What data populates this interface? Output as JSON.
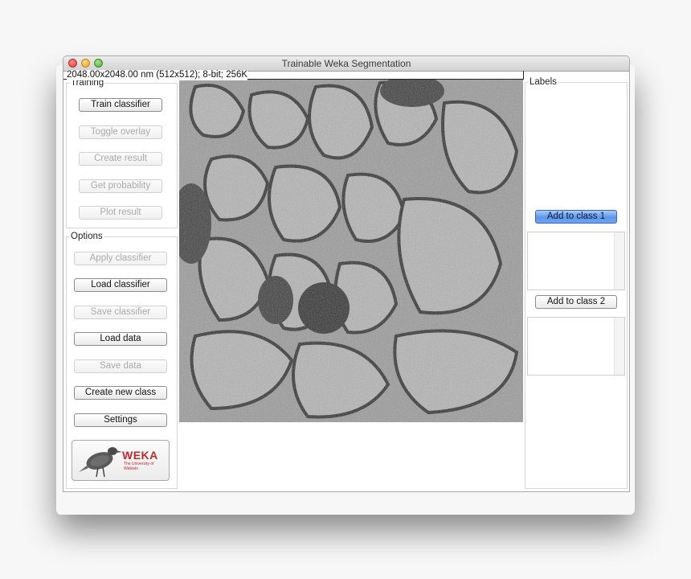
{
  "window": {
    "title": "Trainable Weka Segmentation",
    "controls": [
      "close",
      "minimize",
      "maximize"
    ]
  },
  "image": {
    "info": "2048.00x2048.00 nm (512x512); 8-bit; 256K",
    "description": "Grayscale electron microscopy image of neural tissue"
  },
  "training": {
    "legend": "Training",
    "buttons": [
      {
        "label": "Train classifier",
        "enabled": true
      },
      {
        "label": "Toggle overlay",
        "enabled": false
      },
      {
        "label": "Create result",
        "enabled": false
      },
      {
        "label": "Get probability",
        "enabled": false
      },
      {
        "label": "Plot result",
        "enabled": false
      }
    ]
  },
  "options": {
    "legend": "Options",
    "buttons": [
      {
        "label": "Apply classifier",
        "enabled": false
      },
      {
        "label": "Load classifier",
        "enabled": true
      },
      {
        "label": "Save classifier",
        "enabled": false
      },
      {
        "label": "Load data",
        "enabled": true
      },
      {
        "label": "Save data",
        "enabled": false
      },
      {
        "label": "Create new class",
        "enabled": true
      },
      {
        "label": "Settings",
        "enabled": true
      }
    ],
    "logo": {
      "title": "WEKA",
      "subtitle": "The University of Waikato"
    }
  },
  "labels": {
    "legend": "Labels",
    "classes": [
      {
        "button": "Add to class 1",
        "selected": true,
        "color": "#5d97ec"
      },
      {
        "button": "Add to class 2",
        "selected": false
      }
    ]
  }
}
